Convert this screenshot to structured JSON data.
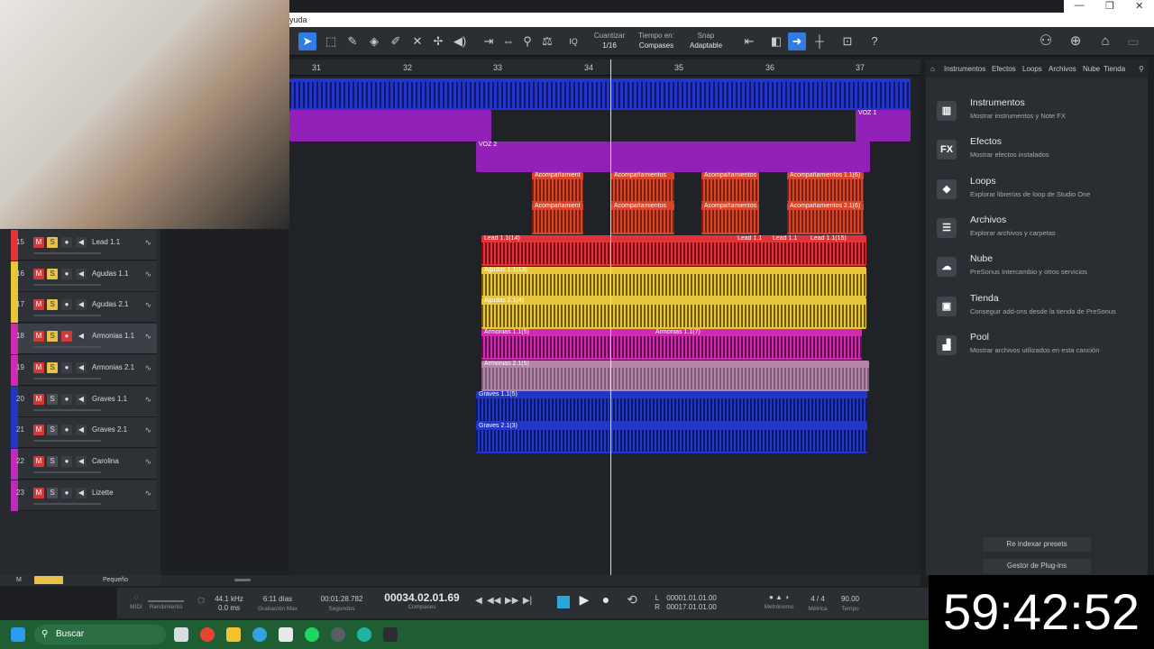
{
  "window": {
    "title_fragment": "yuda",
    "controls": [
      "—",
      "❐",
      "✕"
    ]
  },
  "toolbar": {
    "quantize_label": "Cuantizar",
    "quantize_value": "1/16",
    "timebase_label": "Tiempo en:",
    "timebase_value": "Compases",
    "snap_label": "Snap",
    "snap_value": "Adaptable",
    "iq_label": "IQ",
    "help_label": "?"
  },
  "ruler": {
    "bars": [
      "31",
      "32",
      "33",
      "34",
      "35",
      "36",
      "37"
    ]
  },
  "clips": {
    "voz1": "VOZ 1",
    "voz2": "VOZ 2",
    "acomp1": "Acompañamient",
    "acomp2": "Acompañamientos",
    "acomp3": "Acompañamientos",
    "acomp4": "Acompañamientos 1.1(6)",
    "acomp5": "Acompañamient",
    "acomp6": "Acompañamientos",
    "acomp7": "Acompañamientos",
    "acomp8": "Acompañamientos 2.1(6)",
    "lead_a": "Lead 1.1(14)",
    "lead_b": "Lead 1.1",
    "lead_c": "Lead 1.1",
    "lead_d": "Lead 1.1(15)",
    "agudas1": "Agudas 1.1(13)",
    "agudas2": "Agudas 2.1(4)",
    "armonias1a": "Armonias 1.1(5)",
    "armonias1b": "Armonias 1.1(7)",
    "armonias2": "Armonias 2.1(5)",
    "graves1": "Graves 1.1(5)",
    "graves2": "Graves 2.1(3)"
  },
  "tracks": [
    {
      "num": "15",
      "name": "Lead 1.1",
      "color": "#e0343a"
    },
    {
      "num": "16",
      "name": "Agudas 1.1",
      "color": "#e8c53a"
    },
    {
      "num": "17",
      "name": "Agudas 2.1",
      "color": "#e8c53a"
    },
    {
      "num": "18",
      "name": "Armonias 1.1",
      "color": "#d12ab0"
    },
    {
      "num": "19",
      "name": "Armonias 2.1",
      "color": "#d12ab0"
    },
    {
      "num": "20",
      "name": "Graves 1.1",
      "color": "#2236c8"
    },
    {
      "num": "21",
      "name": "Graves 2.1",
      "color": "#2236c8"
    },
    {
      "num": "22",
      "name": "Carolina",
      "color": "#c02ab8"
    },
    {
      "num": "23",
      "name": "Lizette",
      "color": "#c02ab8"
    }
  ],
  "track_buttons": {
    "m": "M",
    "s": "S"
  },
  "bottom_left": {
    "m": "M",
    "size": "Pequeño"
  },
  "transport": {
    "midi": "MIDI",
    "rendimiento": "Rendimiento",
    "sample_rate": "44.1 kHz",
    "latency": "0.0 ms",
    "record_days": "6:11 días",
    "record_max": "Grabación Max",
    "seconds_time": "00:01:28.782",
    "seconds_label": "Segundos",
    "position": "00034.02.01.69",
    "position_label": "Compases",
    "loop_l": "00001.01.01.00",
    "loop_r": "00017.01.01.00",
    "l": "L",
    "r": "R",
    "metronome": "Metrónomo",
    "time_sig": "4 / 4",
    "metric": "Métrica",
    "tempo": "90.00",
    "tempo_label": "Tempo"
  },
  "browser": {
    "tabs": [
      "Instrumentos",
      "Efectos",
      "Loops",
      "Archivos",
      "Nube",
      "Tienda"
    ],
    "items": [
      {
        "title": "Instrumentos",
        "desc": "Mostrar instrumentos y Note FX",
        "icon": "piano-icon",
        "glyph": "▥"
      },
      {
        "title": "Efectos",
        "desc": "Mostrar efectos instalados",
        "icon": "fx-icon",
        "glyph": "FX"
      },
      {
        "title": "Loops",
        "desc": "Explorar librerías de loop de Studio One",
        "icon": "loops-icon",
        "glyph": "◆"
      },
      {
        "title": "Archivos",
        "desc": "Explorar archivos y carpetas",
        "icon": "files-icon",
        "glyph": "☰"
      },
      {
        "title": "Nube",
        "desc": "PreSonus Intercambio y otros servicios",
        "icon": "cloud-icon",
        "glyph": "☁"
      },
      {
        "title": "Tienda",
        "desc": "Conseguir add-ons desde la tienda de PreSonus",
        "icon": "shop-icon",
        "glyph": "▣"
      },
      {
        "title": "Pool",
        "desc": "Mostrar archivos utilizados en esta canción",
        "icon": "pool-icon",
        "glyph": "▟"
      }
    ],
    "reindex_label": "Re indexar presets",
    "plugin_manager_label": "Gestor de Plug-ins"
  },
  "timer": "59:42:52",
  "taskbar": {
    "search_placeholder": "Buscar"
  }
}
